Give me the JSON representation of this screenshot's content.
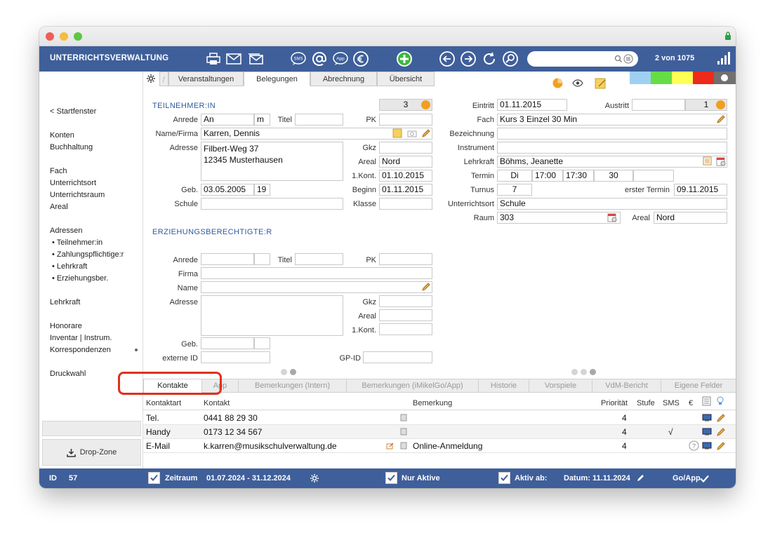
{
  "app": {
    "title": "UNTERRICHTSVERWALTUNG",
    "counter": "2 von 1075"
  },
  "topbar": {
    "icons": [
      "printer-icon",
      "mail-icon",
      "mail-multi-icon",
      "sms-icon",
      "at-icon",
      "app-icon",
      "euro-icon",
      "add-icon",
      "back-icon",
      "forward-icon",
      "refresh-icon",
      "search-zoom-icon"
    ],
    "sms_label": "SMS",
    "app_label": "App",
    "search_placeholder": ""
  },
  "sidebar": {
    "back": "< Startfenster",
    "group1": [
      "Konten",
      "Buchhaltung"
    ],
    "group2": [
      "Fach",
      "Unterrichtsort",
      "Unterrichtsraum",
      "Areal"
    ],
    "adressen": "Adressen",
    "adressen_sub": [
      "• Teilnehmer:in",
      "• Zahlungspflichtige:r",
      "• Lehrkraft",
      "• Erziehungsber."
    ],
    "lehrkraft": "Lehrkraft",
    "group4": [
      "Honorare",
      "Inventar | Instrum.",
      "Korrespondenzen"
    ],
    "druckwahl": "Druckwahl",
    "dropzone": "Drop-Zone"
  },
  "tabs_top": [
    "Veranstaltungen",
    "Belegungen",
    "Abrechnung",
    "Übersicht"
  ],
  "tabs_top_active": "Belegungen",
  "colors": {
    "header": "#3f5f9a",
    "band": [
      "#9fd0f2",
      "#66dd44",
      "#ffff55",
      "#ee2a1c",
      "#707070"
    ],
    "highlight": "#e0301e"
  },
  "teilnehmer": {
    "section": "TEILNEHMER:IN",
    "count": "3",
    "labels": {
      "anrede": "Anrede",
      "titel": "Titel",
      "pk": "PK",
      "name": "Name/Firma",
      "adresse": "Adresse",
      "gkz": "Gkz",
      "areal": "Areal",
      "kont": "1.Kont.",
      "geb": "Geb.",
      "beginn": "Beginn",
      "schule": "Schule",
      "klasse": "Klasse"
    },
    "anrede": "An",
    "anrede2": "m",
    "titel": "",
    "pk": "",
    "name": "Karren, Dennis",
    "adresse1": "Filbert-Weg 37",
    "adresse2": "12345 Musterhausen",
    "gkz": "",
    "areal": "Nord",
    "kont": "01.10.2015",
    "geb": "03.05.2005",
    "alter": "19",
    "beginn": "01.11.2015",
    "schule": "",
    "klasse": ""
  },
  "kurs": {
    "labels": {
      "eintritt": "Eintritt",
      "austritt": "Austritt",
      "fach": "Fach",
      "bezeichnung": "Bezeichnung",
      "instrument": "Instrument",
      "lehrkraft": "Lehrkraft",
      "termin": "Termin",
      "turnus": "Turnus",
      "erster": "erster Termin",
      "ort": "Unterrichtsort",
      "raum": "Raum",
      "areal": "Areal"
    },
    "eintritt": "01.11.2015",
    "austritt": "",
    "austritt_count": "1",
    "fach": "Kurs 3 Einzel 30 Min",
    "bezeichnung": "",
    "instrument": "",
    "lehrkraft": "Böhms, Jeanette",
    "termin_tag": "Di",
    "termin_von": "17:00",
    "termin_bis": "17:30",
    "termin_dauer": "30",
    "termin_extra": "",
    "turnus": "7",
    "erster_termin": "09.11.2015",
    "ort": "Schule",
    "raum": "303",
    "areal": "Nord"
  },
  "erzieher": {
    "section": "ERZIEHUNGSBERECHTIGTE:R",
    "labels": {
      "anrede": "Anrede",
      "titel": "Titel",
      "pk": "PK",
      "firma": "Firma",
      "name": "Name",
      "adresse": "Adresse",
      "gkz": "Gkz",
      "areal": "Areal",
      "kont": "1.Kont.",
      "geb": "Geb.",
      "extern": "externe ID",
      "gpid": "GP-ID"
    }
  },
  "tabs_bottom": [
    "Kontakte",
    "App",
    "Bemerkungen (Intern)",
    "Bemerkungen (iMikelGo/App)",
    "Historie",
    "Vorspiele",
    "VdM-Bericht",
    "Eigene Felder"
  ],
  "contacts": {
    "headers": {
      "art": "Kontaktart",
      "kontakt": "Kontakt",
      "bemerkung": "Bemerkung",
      "prio": "Priorität",
      "stufe": "Stufe",
      "sms": "SMS",
      "euro": "€"
    },
    "rows": [
      {
        "art": "Tel.",
        "kontakt": "0441 88 29 30",
        "bemerkung": "",
        "prio": "4",
        "sms": ""
      },
      {
        "art": "Handy",
        "kontakt": "0173 12 34 567",
        "bemerkung": "",
        "prio": "4",
        "sms": "√"
      },
      {
        "art": "E-Mail",
        "kontakt": "k.karren@musikschulverwaltung.de",
        "bemerkung": "Online-Anmeldung",
        "prio": "4",
        "sms": ""
      }
    ]
  },
  "status": {
    "id_label": "ID",
    "id": "57",
    "zeitraum_label": "Zeitraum",
    "zeitraum": "01.07.2024  -  31.12.2024",
    "nur_aktive": "Nur Aktive",
    "aktiv_ab": "Aktiv ab:",
    "datum": "Datum: 11.11.2024",
    "goapp": "Go/App"
  }
}
